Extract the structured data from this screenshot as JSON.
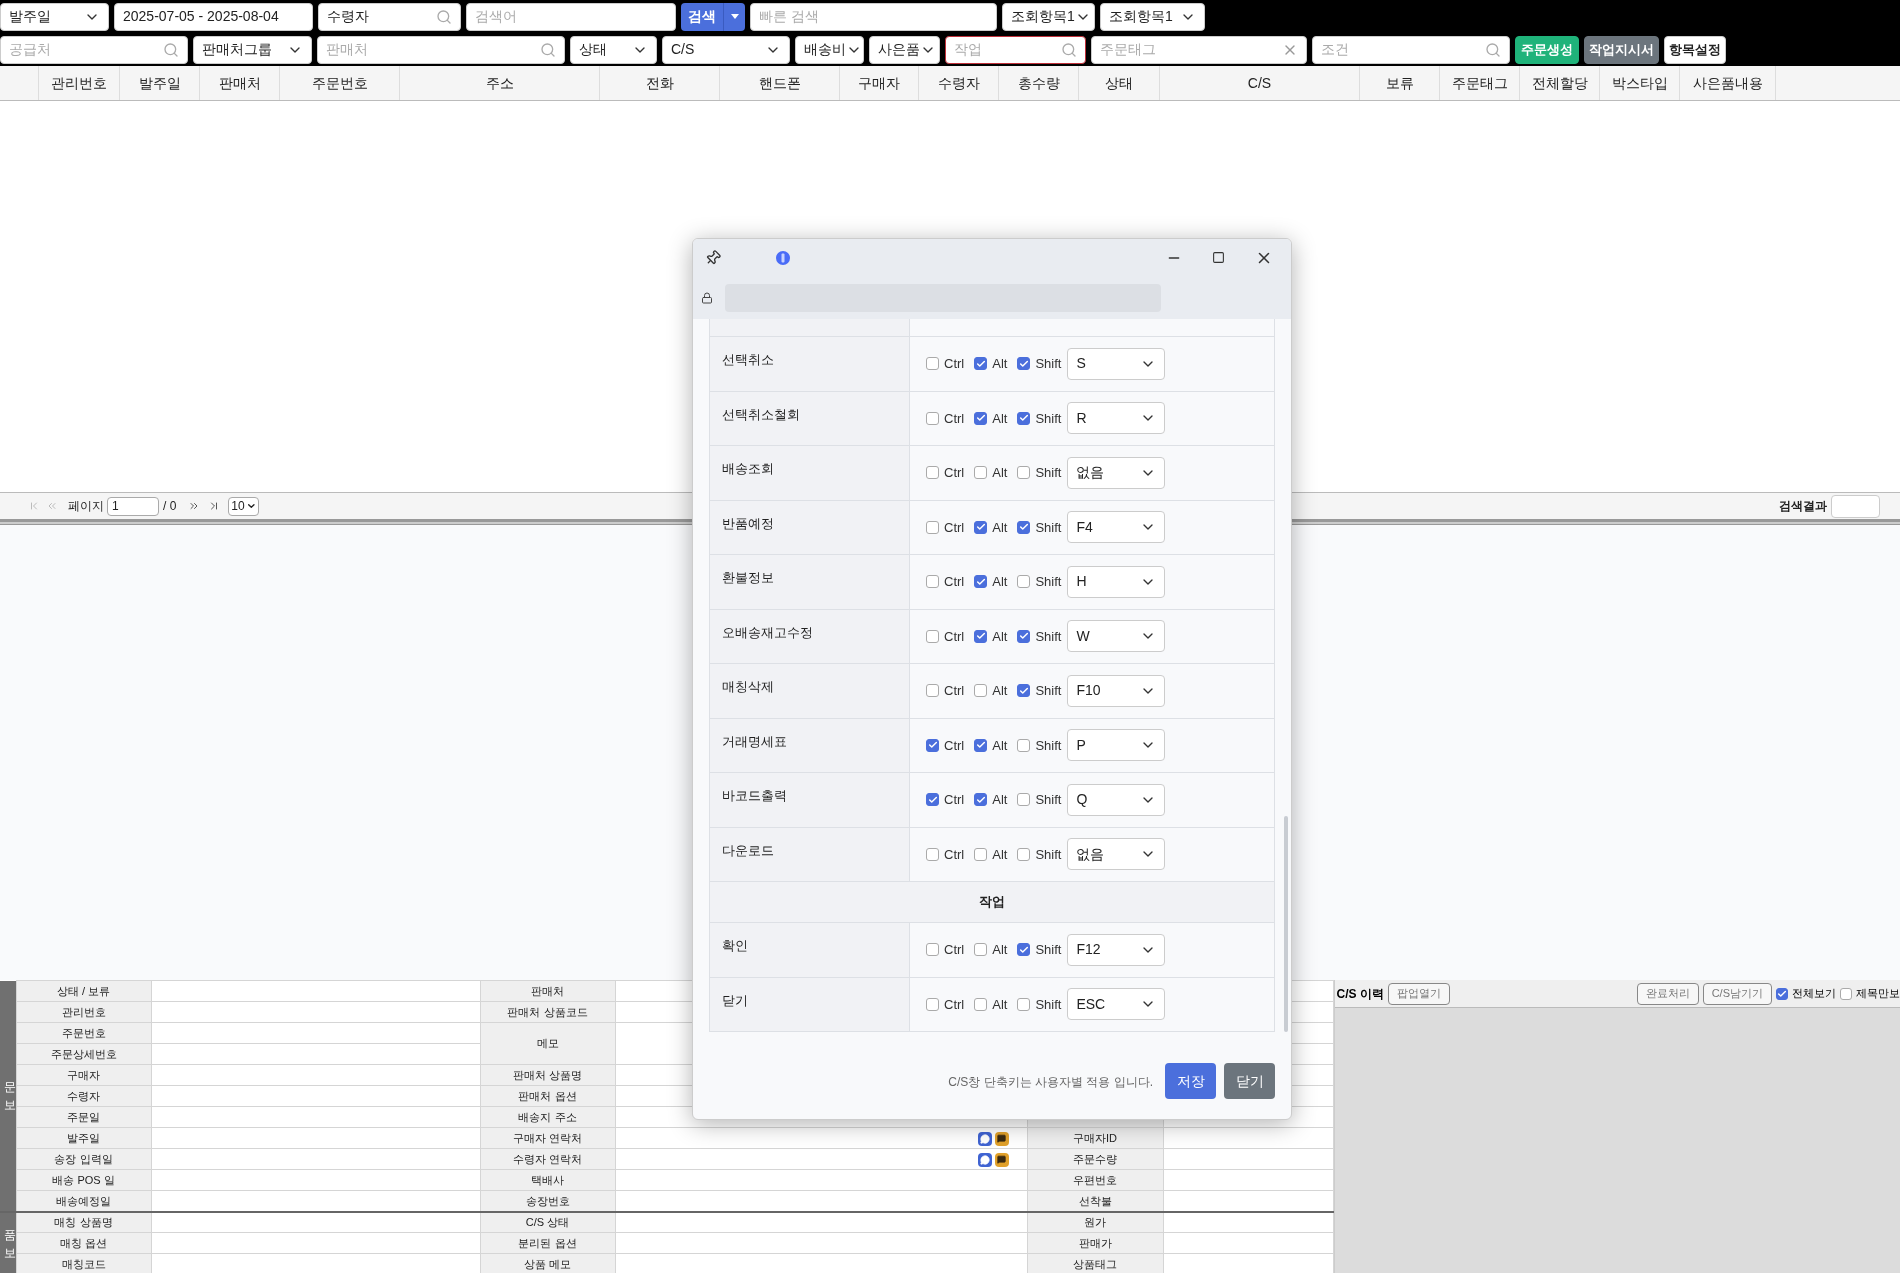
{
  "toolbar": {
    "search_bar": [
      {
        "kind": "select",
        "value": "발주일"
      },
      {
        "kind": "text",
        "value": "2025-07-05 - 2025-08-04"
      },
      {
        "kind": "search",
        "value": "수령자"
      },
      {
        "kind": "text",
        "placeholder": "검색어"
      },
      {
        "kind": "split",
        "label": "검색"
      },
      {
        "kind": "text",
        "placeholder": "빠른 검색"
      },
      {
        "kind": "select",
        "value": "조회항목1"
      },
      {
        "kind": "select",
        "value": "조회항목1"
      }
    ],
    "filter_bar": [
      {
        "kind": "search",
        "placeholder": "공급처"
      },
      {
        "kind": "select",
        "value": "판매처그룹"
      },
      {
        "kind": "search",
        "placeholder": "판매처"
      },
      {
        "kind": "select",
        "value": "상태"
      },
      {
        "kind": "select",
        "value": "C/S"
      },
      {
        "kind": "select",
        "value": "배송비"
      },
      {
        "kind": "select",
        "value": "사은품"
      },
      {
        "kind": "search",
        "placeholder": "작업",
        "highlighted": true
      },
      {
        "kind": "clear",
        "placeholder": "주문태그"
      },
      {
        "kind": "search",
        "placeholder": "조건"
      },
      {
        "kind": "button",
        "label": "주문생성",
        "color": "#1fb37a"
      },
      {
        "kind": "button",
        "label": "작업지시서",
        "color": "#6c757d"
      },
      {
        "kind": "button",
        "label": "항목설정",
        "color": "#ffffff"
      }
    ]
  },
  "grid": {
    "columns": [
      "관리번호",
      "발주일",
      "판매처",
      "주문번호",
      "주소",
      "전화",
      "핸드폰",
      "구매자",
      "수령자",
      "총수량",
      "상태",
      "C/S",
      "보류",
      "주문태그",
      "전체할당",
      "박스타입",
      "사은품내용"
    ]
  },
  "pager": {
    "label": "페이지",
    "page": "1",
    "total": "/ 0",
    "page_size": "10",
    "result_label": "검색결과"
  },
  "detail": {
    "groups": [
      {
        "side_label": [
          "문",
          "보"
        ],
        "rows": [
          {
            "label": "상태 / 보류",
            "label2": "판매처"
          },
          {
            "label": "관리번호",
            "label2": "판매처 상품코드"
          },
          {
            "label": "주문번호",
            "label2": "메모",
            "merge_next": true
          },
          {
            "label": "주문상세번호"
          },
          {
            "label": "구매자",
            "label2": "판매처 상품명"
          },
          {
            "label": "수령자",
            "label2": "판매처 옵션"
          },
          {
            "label": "주문일",
            "label2": "배송지 주소"
          },
          {
            "label": "발주일",
            "label2": "구매자 연락처",
            "label3": "구매자ID",
            "contact_icons": true
          },
          {
            "label": "송장 입력일",
            "label2": "수령자 연락처",
            "label3": "주문수량",
            "contact_icons": true
          },
          {
            "label": "배송 POS 일",
            "label2": "택배사",
            "label3": "우편번호"
          },
          {
            "label": "배송예정일",
            "label2": "송장번호",
            "label3": "선착불"
          }
        ]
      },
      {
        "side_label": [
          "품",
          "보"
        ],
        "rows": [
          {
            "label": "매칭 상품명",
            "label2": "C/S 상태",
            "label3": "원가"
          },
          {
            "label": "매칭 옵션",
            "label2": "분리된 옵션",
            "label3": "판매가"
          },
          {
            "label": "매칭코드",
            "label2": "상품 메모",
            "label3": "상품태그"
          }
        ]
      }
    ]
  },
  "cs_panel": {
    "title": "C/S 이력",
    "popup_button": "팝업열기",
    "buttons": [
      "완료처리",
      "C/S남기기"
    ],
    "checks": [
      {
        "label": "전체보기",
        "checked": true
      },
      {
        "label": "제목만보",
        "checked": false
      }
    ]
  },
  "dialog": {
    "rows": [
      {
        "kind": "shortcut",
        "label": "선택취소",
        "modifiers": [
          {
            "label": "Ctrl",
            "checked": false
          },
          {
            "label": "Alt",
            "checked": true
          },
          {
            "label": "Shift",
            "checked": true
          }
        ],
        "key": "S"
      },
      {
        "kind": "shortcut",
        "label": "선택취소철회",
        "modifiers": [
          {
            "label": "Ctrl",
            "checked": false
          },
          {
            "label": "Alt",
            "checked": true
          },
          {
            "label": "Shift",
            "checked": true
          }
        ],
        "key": "R"
      },
      {
        "kind": "shortcut",
        "label": "배송조회",
        "modifiers": [
          {
            "label": "Ctrl",
            "checked": false
          },
          {
            "label": "Alt",
            "checked": false
          },
          {
            "label": "Shift",
            "checked": false
          }
        ],
        "key": "없음"
      },
      {
        "kind": "shortcut",
        "label": "반품예정",
        "modifiers": [
          {
            "label": "Ctrl",
            "checked": false
          },
          {
            "label": "Alt",
            "checked": true
          },
          {
            "label": "Shift",
            "checked": true
          }
        ],
        "key": "F4"
      },
      {
        "kind": "shortcut",
        "label": "환불정보",
        "modifiers": [
          {
            "label": "Ctrl",
            "checked": false
          },
          {
            "label": "Alt",
            "checked": true
          },
          {
            "label": "Shift",
            "checked": false
          }
        ],
        "key": "H"
      },
      {
        "kind": "shortcut",
        "label": "오배송재고수정",
        "modifiers": [
          {
            "label": "Ctrl",
            "checked": false
          },
          {
            "label": "Alt",
            "checked": true
          },
          {
            "label": "Shift",
            "checked": true
          }
        ],
        "key": "W"
      },
      {
        "kind": "shortcut",
        "label": "매칭삭제",
        "modifiers": [
          {
            "label": "Ctrl",
            "checked": false
          },
          {
            "label": "Alt",
            "checked": false
          },
          {
            "label": "Shift",
            "checked": true
          }
        ],
        "key": "F10"
      },
      {
        "kind": "shortcut",
        "label": "거래명세표",
        "modifiers": [
          {
            "label": "Ctrl",
            "checked": true
          },
          {
            "label": "Alt",
            "checked": true
          },
          {
            "label": "Shift",
            "checked": false
          }
        ],
        "key": "P"
      },
      {
        "kind": "shortcut",
        "label": "바코드출력",
        "modifiers": [
          {
            "label": "Ctrl",
            "checked": true
          },
          {
            "label": "Alt",
            "checked": true
          },
          {
            "label": "Shift",
            "checked": false
          }
        ],
        "key": "Q"
      },
      {
        "kind": "shortcut",
        "label": "다운로드",
        "modifiers": [
          {
            "label": "Ctrl",
            "checked": false
          },
          {
            "label": "Alt",
            "checked": false
          },
          {
            "label": "Shift",
            "checked": false
          }
        ],
        "key": "없음"
      },
      {
        "kind": "section",
        "label": "작업"
      },
      {
        "kind": "shortcut",
        "label": "확인",
        "modifiers": [
          {
            "label": "Ctrl",
            "checked": false
          },
          {
            "label": "Alt",
            "checked": false
          },
          {
            "label": "Shift",
            "checked": true
          }
        ],
        "key": "F12"
      },
      {
        "kind": "shortcut",
        "label": "닫기",
        "modifiers": [
          {
            "label": "Ctrl",
            "checked": false
          },
          {
            "label": "Alt",
            "checked": false
          },
          {
            "label": "Shift",
            "checked": false
          }
        ],
        "key": "ESC"
      }
    ],
    "note": "C/S창 단축키는 사용자별 적용 입니다.",
    "buttons": [
      {
        "label": "저장",
        "color": "#4b6fdc"
      },
      {
        "label": "닫기",
        "color": "#6c757d"
      }
    ]
  }
}
